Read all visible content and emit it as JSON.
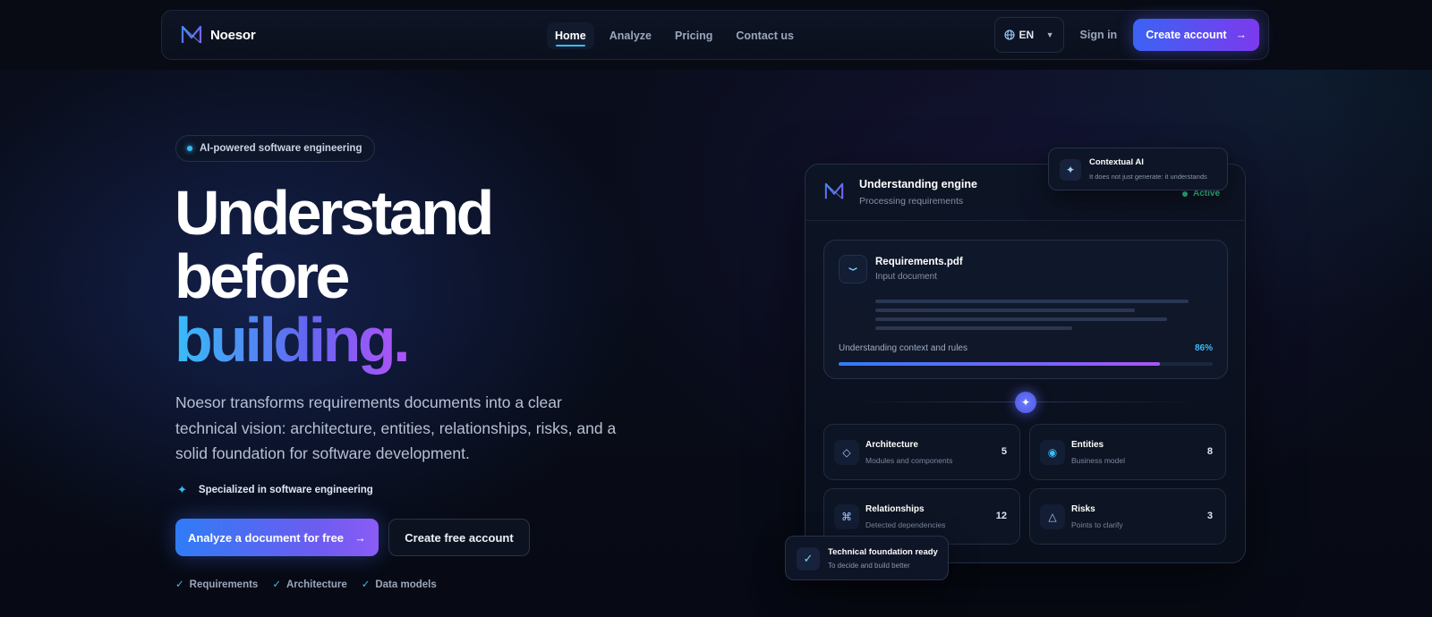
{
  "brand": {
    "name": "Noesor"
  },
  "nav": {
    "links": [
      "Home",
      "Analyze",
      "Pricing",
      "Contact us"
    ],
    "active": "Home",
    "language": "EN",
    "signin_label": "Sign in",
    "create_account_label": "Create account",
    "arrow": "→"
  },
  "hero": {
    "badge": "AI-powered software engineering",
    "headline_line1": "Understand",
    "headline_line2": "before",
    "headline_line3": "building",
    "headline_period": ".",
    "description": "Noesor transforms requirements documents into a clear technical vision: architecture, entities, relationships, risks, and a solid foundation for software development.",
    "specialized": "Specialized in software engineering",
    "cta_primary": "Analyze a document for free",
    "cta_arrow": "→",
    "cta_secondary": "Create free account",
    "checks": [
      "Requirements",
      "Architecture",
      "Data models"
    ],
    "check_glyph": "✓"
  },
  "engine": {
    "title": "Understanding engine",
    "subtitle": "Processing requirements",
    "status": "Active",
    "document": {
      "name": "Requirements.pdf",
      "label": "Input document",
      "progress_label": "Understanding context and rules",
      "progress_text": "86%",
      "progress": 0.86
    },
    "stats": [
      {
        "title": "Architecture",
        "subtitle": "Modules and components",
        "count": "5",
        "icon": "diamond-icon"
      },
      {
        "title": "Entities",
        "subtitle": "Business model",
        "count": "8",
        "icon": "target-icon"
      },
      {
        "title": "Relationships",
        "subtitle": "Detected dependencies",
        "count": "12",
        "icon": "command-icon"
      },
      {
        "title": "Risks",
        "subtitle": "Points to clarify",
        "count": "3",
        "icon": "warning-triangle-icon"
      }
    ]
  },
  "floating": {
    "contextual": {
      "title": "Contextual AI",
      "subtitle": "It does not just generate: it understands"
    },
    "technical": {
      "title": "Technical foundation ready",
      "subtitle": "To decide and build better"
    }
  },
  "colors": {
    "accent": "#38bdf8",
    "brand_start": "#3b63f5",
    "brand_end": "#7c3aed",
    "active": "#34d399"
  }
}
